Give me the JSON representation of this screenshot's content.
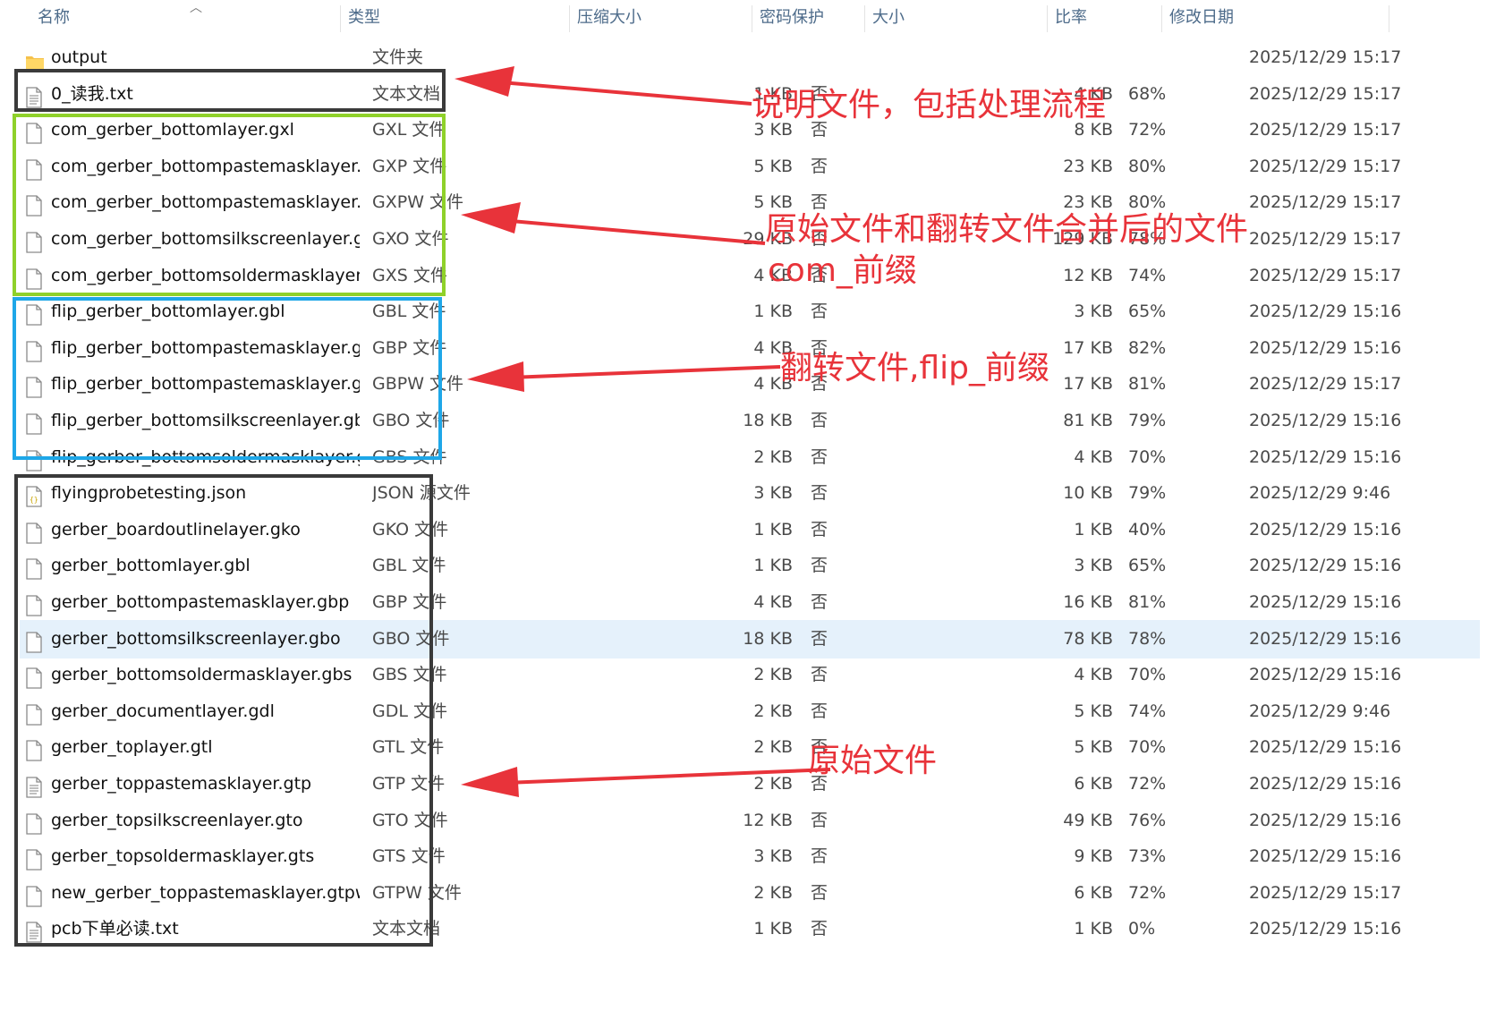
{
  "header": {
    "columns": [
      "名称",
      "类型",
      "压缩大小",
      "密码保护",
      "大小",
      "比率",
      "修改日期"
    ]
  },
  "rows": [
    {
      "icon": "folder-icon",
      "name": "output",
      "type": "文件夹",
      "csize": "",
      "pw": "",
      "size": "",
      "ratio": "",
      "date": "2025/12/29 15:17"
    },
    {
      "icon": "text-file-icon",
      "name": "0_读我.txt",
      "type": "文本文档",
      "csize": "1 KB",
      "pw": "否",
      "size": "4 KB",
      "ratio": "68%",
      "date": "2025/12/29 15:17"
    },
    {
      "icon": "file-icon",
      "name": "com_gerber_bottomlayer.gxl",
      "type": "GXL 文件",
      "csize": "3 KB",
      "pw": "否",
      "size": "8 KB",
      "ratio": "72%",
      "date": "2025/12/29 15:17"
    },
    {
      "icon": "file-icon",
      "name": "com_gerber_bottompastemasklayer....",
      "type": "GXP 文件",
      "csize": "5 KB",
      "pw": "否",
      "size": "23 KB",
      "ratio": "80%",
      "date": "2025/12/29 15:17"
    },
    {
      "icon": "file-icon",
      "name": "com_gerber_bottompastemasklayer....",
      "type": "GXPW 文件",
      "csize": "5 KB",
      "pw": "否",
      "size": "23 KB",
      "ratio": "80%",
      "date": "2025/12/29 15:17"
    },
    {
      "icon": "file-icon",
      "name": "com_gerber_bottomsilkscreenlayer.g...",
      "type": "GXO 文件",
      "csize": "29 KB",
      "pw": "否",
      "size": "129 KB",
      "ratio": "78%",
      "date": "2025/12/29 15:17"
    },
    {
      "icon": "file-icon",
      "name": "com_gerber_bottomsoldermasklayer....",
      "type": "GXS 文件",
      "csize": "4 KB",
      "pw": "否",
      "size": "12 KB",
      "ratio": "74%",
      "date": "2025/12/29 15:17"
    },
    {
      "icon": "file-icon",
      "name": "flip_gerber_bottomlayer.gbl",
      "type": "GBL 文件",
      "csize": "1 KB",
      "pw": "否",
      "size": "3 KB",
      "ratio": "65%",
      "date": "2025/12/29 15:16"
    },
    {
      "icon": "file-icon",
      "name": "flip_gerber_bottompastemasklayer.g...",
      "type": "GBP 文件",
      "csize": "4 KB",
      "pw": "否",
      "size": "17 KB",
      "ratio": "82%",
      "date": "2025/12/29 15:16"
    },
    {
      "icon": "file-icon",
      "name": "flip_gerber_bottompastemasklayer.g...",
      "type": "GBPW 文件",
      "csize": "4 KB",
      "pw": "否",
      "size": "17 KB",
      "ratio": "81%",
      "date": "2025/12/29 15:17"
    },
    {
      "icon": "file-icon",
      "name": "flip_gerber_bottomsilkscreenlayer.gbo",
      "type": "GBO 文件",
      "csize": "18 KB",
      "pw": "否",
      "size": "81 KB",
      "ratio": "79%",
      "date": "2025/12/29 15:16"
    },
    {
      "icon": "file-icon",
      "name": "flip_gerber_bottomsoldermasklayer.g...",
      "type": "GBS 文件",
      "csize": "2 KB",
      "pw": "否",
      "size": "4 KB",
      "ratio": "70%",
      "date": "2025/12/29 15:16"
    },
    {
      "icon": "json-file-icon",
      "name": "flyingprobetesting.json",
      "type": "JSON 源文件",
      "csize": "3 KB",
      "pw": "否",
      "size": "10 KB",
      "ratio": "79%",
      "date": "2025/12/29 9:46"
    },
    {
      "icon": "file-icon",
      "name": "gerber_boardoutlinelayer.gko",
      "type": "GKO 文件",
      "csize": "1 KB",
      "pw": "否",
      "size": "1 KB",
      "ratio": "40%",
      "date": "2025/12/29 15:16"
    },
    {
      "icon": "file-icon",
      "name": "gerber_bottomlayer.gbl",
      "type": "GBL 文件",
      "csize": "1 KB",
      "pw": "否",
      "size": "3 KB",
      "ratio": "65%",
      "date": "2025/12/29 15:16"
    },
    {
      "icon": "file-icon",
      "name": "gerber_bottompastemasklayer.gbp",
      "type": "GBP 文件",
      "csize": "4 KB",
      "pw": "否",
      "size": "16 KB",
      "ratio": "81%",
      "date": "2025/12/29 15:16"
    },
    {
      "icon": "file-icon",
      "name": "gerber_bottomsilkscreenlayer.gbo",
      "type": "GBO 文件",
      "csize": "18 KB",
      "pw": "否",
      "size": "78 KB",
      "ratio": "78%",
      "date": "2025/12/29 15:16",
      "selected": true
    },
    {
      "icon": "file-icon",
      "name": "gerber_bottomsoldermasklayer.gbs",
      "type": "GBS 文件",
      "csize": "2 KB",
      "pw": "否",
      "size": "4 KB",
      "ratio": "70%",
      "date": "2025/12/29 15:16"
    },
    {
      "icon": "file-icon",
      "name": "gerber_documentlayer.gdl",
      "type": "GDL 文件",
      "csize": "2 KB",
      "pw": "否",
      "size": "5 KB",
      "ratio": "74%",
      "date": "2025/12/29 9:46"
    },
    {
      "icon": "file-icon",
      "name": "gerber_toplayer.gtl",
      "type": "GTL 文件",
      "csize": "2 KB",
      "pw": "否",
      "size": "5 KB",
      "ratio": "70%",
      "date": "2025/12/29 15:16"
    },
    {
      "icon": "text-file-icon",
      "name": "gerber_toppastemasklayer.gtp",
      "type": "GTP 文件",
      "csize": "2 KB",
      "pw": "否",
      "size": "6 KB",
      "ratio": "72%",
      "date": "2025/12/29 15:16"
    },
    {
      "icon": "file-icon",
      "name": "gerber_topsilkscreenlayer.gto",
      "type": "GTO 文件",
      "csize": "12 KB",
      "pw": "否",
      "size": "49 KB",
      "ratio": "76%",
      "date": "2025/12/29 15:16"
    },
    {
      "icon": "file-icon",
      "name": "gerber_topsoldermasklayer.gts",
      "type": "GTS 文件",
      "csize": "3 KB",
      "pw": "否",
      "size": "9 KB",
      "ratio": "73%",
      "date": "2025/12/29 15:16"
    },
    {
      "icon": "file-icon",
      "name": "new_gerber_toppastemasklayer.gtpw",
      "type": "GTPW 文件",
      "csize": "2 KB",
      "pw": "否",
      "size": "6 KB",
      "ratio": "72%",
      "date": "2025/12/29 15:17"
    },
    {
      "icon": "text-file-icon",
      "name": "pcb下单必读.txt",
      "type": "文本文档",
      "csize": "1 KB",
      "pw": "否",
      "size": "1 KB",
      "ratio": "0%",
      "date": "2025/12/29 15:16"
    }
  ],
  "annotations": {
    "readme": "说明文件，包括处理流程",
    "merged_line1": "原始文件和翻转文件合并后的文件",
    "merged_line2": "com_前缀",
    "flip": "翻转文件,flip_前缀",
    "original": "原始文件"
  },
  "colors": {
    "annotation_red": "#e8333a",
    "box_dark": "#3a3a3a",
    "box_green": "#8fd12a",
    "box_blue": "#1ea7e8",
    "selection": "#e5f1fb",
    "header_text": "#4d6b8a"
  }
}
